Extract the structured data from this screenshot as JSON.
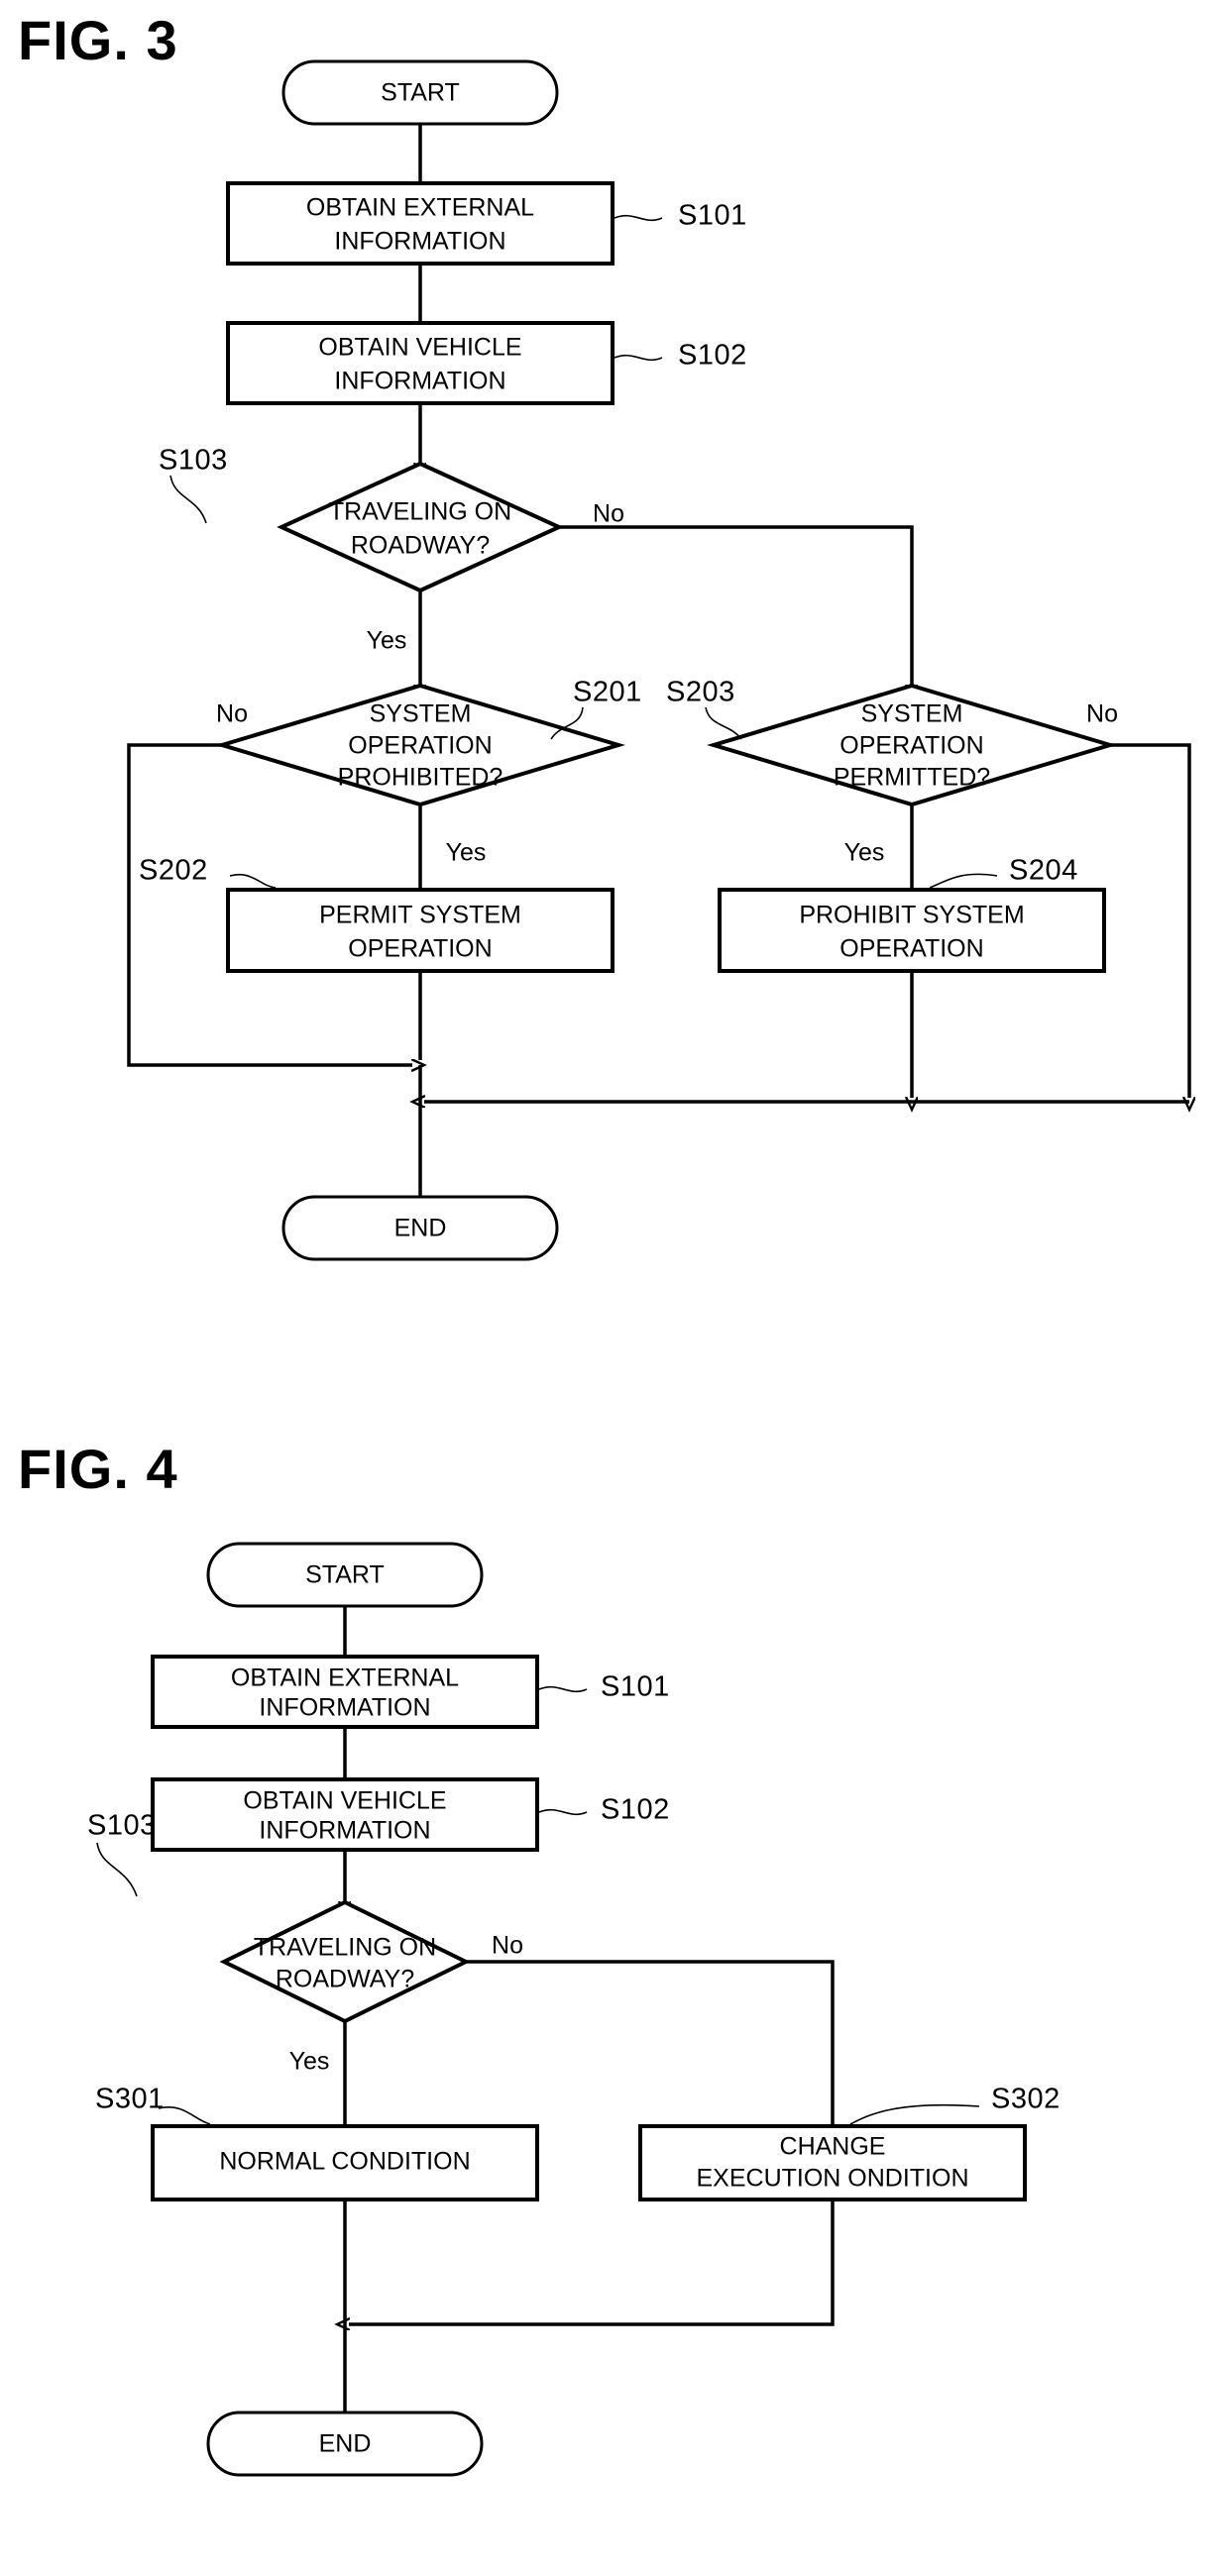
{
  "document": {
    "type": "patent-drawing-sheet",
    "figures": [
      "FIG. 3",
      "FIG. 4"
    ]
  },
  "fig3": {
    "label": "FIG. 3",
    "nodes": {
      "start": "START",
      "s101_line1": "OBTAIN EXTERNAL",
      "s101_line2": "INFORMATION",
      "s102_line1": "OBTAIN VEHICLE",
      "s102_line2": "INFORMATION",
      "s103_line1": "TRAVELING ON",
      "s103_line2": "ROADWAY?",
      "s201_line1": "SYSTEM",
      "s201_line2": "OPERATION",
      "s201_line3": "PROHIBITED?",
      "s203_line1": "SYSTEM",
      "s203_line2": "OPERATION",
      "s203_line3": "PERMITTED?",
      "s202_line1": "PERMIT SYSTEM",
      "s202_line2": "OPERATION",
      "s204_line1": "PROHIBIT SYSTEM",
      "s204_line2": "OPERATION",
      "end": "END"
    },
    "step_labels": {
      "s101": "S101",
      "s102": "S102",
      "s103": "S103",
      "s201": "S201",
      "s202": "S202",
      "s203": "S203",
      "s204": "S204"
    },
    "branches": {
      "s103_no": "No",
      "s103_yes": "Yes",
      "s201_no": "No",
      "s201_yes": "Yes",
      "s203_no": "No",
      "s203_yes": "Yes"
    }
  },
  "fig4": {
    "label": "FIG. 4",
    "nodes": {
      "start": "START",
      "s101_line1": "OBTAIN EXTERNAL",
      "s101_line2": "INFORMATION",
      "s102_line1": "OBTAIN VEHICLE",
      "s102_line2": "INFORMATION",
      "s103_line1": "TRAVELING ON",
      "s103_line2": "ROADWAY?",
      "s301": "NORMAL CONDITION",
      "s302_line1": "CHANGE",
      "s302_line2": "EXECUTION ONDITION",
      "end": "END"
    },
    "step_labels": {
      "s101": "S101",
      "s102": "S102",
      "s103": "S103",
      "s301": "S301",
      "s302": "S302"
    },
    "branches": {
      "s103_no": "No",
      "s103_yes": "Yes"
    }
  },
  "chart_data": {
    "type": "diagram",
    "title": "Patent flowcharts FIG. 3 and FIG. 4",
    "diagrams": [
      {
        "name": "FIG. 3",
        "kind": "flowchart",
        "nodes": [
          {
            "id": "start",
            "shape": "terminator",
            "text": "START"
          },
          {
            "id": "S101",
            "shape": "process",
            "text": "OBTAIN EXTERNAL INFORMATION"
          },
          {
            "id": "S102",
            "shape": "process",
            "text": "OBTAIN VEHICLE INFORMATION"
          },
          {
            "id": "S103",
            "shape": "decision",
            "text": "TRAVELING ON ROADWAY?"
          },
          {
            "id": "S201",
            "shape": "decision",
            "text": "SYSTEM OPERATION PROHIBITED?"
          },
          {
            "id": "S202",
            "shape": "process",
            "text": "PERMIT SYSTEM OPERATION"
          },
          {
            "id": "S203",
            "shape": "decision",
            "text": "SYSTEM OPERATION PERMITTED?"
          },
          {
            "id": "S204",
            "shape": "process",
            "text": "PROHIBIT SYSTEM OPERATION"
          },
          {
            "id": "end",
            "shape": "terminator",
            "text": "END"
          }
        ],
        "edges": [
          {
            "from": "start",
            "to": "S101",
            "label": ""
          },
          {
            "from": "S101",
            "to": "S102",
            "label": ""
          },
          {
            "from": "S102",
            "to": "S103",
            "label": ""
          },
          {
            "from": "S103",
            "to": "S201",
            "label": "Yes"
          },
          {
            "from": "S103",
            "to": "S203",
            "label": "No"
          },
          {
            "from": "S201",
            "to": "S202",
            "label": "Yes"
          },
          {
            "from": "S201",
            "to": "end",
            "label": "No"
          },
          {
            "from": "S202",
            "to": "end",
            "label": ""
          },
          {
            "from": "S203",
            "to": "S204",
            "label": "Yes"
          },
          {
            "from": "S203",
            "to": "end",
            "label": "No"
          },
          {
            "from": "S204",
            "to": "end",
            "label": ""
          }
        ]
      },
      {
        "name": "FIG. 4",
        "kind": "flowchart",
        "nodes": [
          {
            "id": "start",
            "shape": "terminator",
            "text": "START"
          },
          {
            "id": "S101",
            "shape": "process",
            "text": "OBTAIN EXTERNAL INFORMATION"
          },
          {
            "id": "S102",
            "shape": "process",
            "text": "OBTAIN VEHICLE INFORMATION"
          },
          {
            "id": "S103",
            "shape": "decision",
            "text": "TRAVELING ON ROADWAY?"
          },
          {
            "id": "S301",
            "shape": "process",
            "text": "NORMAL CONDITION"
          },
          {
            "id": "S302",
            "shape": "process",
            "text": "CHANGE EXECUTION ONDITION"
          },
          {
            "id": "end",
            "shape": "terminator",
            "text": "END"
          }
        ],
        "edges": [
          {
            "from": "start",
            "to": "S101",
            "label": ""
          },
          {
            "from": "S101",
            "to": "S102",
            "label": ""
          },
          {
            "from": "S102",
            "to": "S103",
            "label": ""
          },
          {
            "from": "S103",
            "to": "S301",
            "label": "Yes"
          },
          {
            "from": "S103",
            "to": "S302",
            "label": "No"
          },
          {
            "from": "S301",
            "to": "end",
            "label": ""
          },
          {
            "from": "S302",
            "to": "end",
            "label": ""
          }
        ]
      }
    ]
  }
}
